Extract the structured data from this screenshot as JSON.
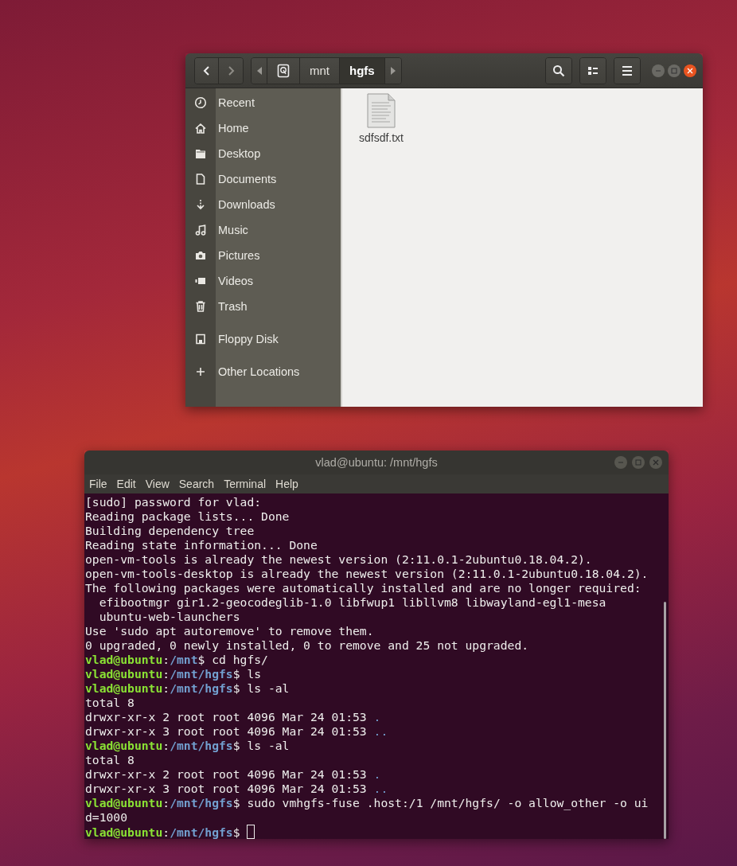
{
  "file_manager": {
    "path_bar": [
      {
        "kind": "drive",
        "selected": false
      },
      {
        "kind": "folder",
        "label": "mnt",
        "selected": false
      },
      {
        "kind": "folder",
        "label": "hgfs",
        "selected": true
      }
    ],
    "sidebar": {
      "sections": [
        [
          {
            "label": "Recent"
          },
          {
            "label": "Home"
          },
          {
            "label": "Desktop"
          },
          {
            "label": "Documents"
          },
          {
            "label": "Downloads"
          },
          {
            "label": "Music"
          },
          {
            "label": "Pictures"
          },
          {
            "label": "Videos"
          },
          {
            "label": "Trash"
          }
        ],
        [
          {
            "label": "Floppy Disk"
          }
        ],
        [
          {
            "label": "Other Locations"
          }
        ]
      ]
    },
    "files": [
      {
        "name": "sdfsdf.txt"
      }
    ]
  },
  "terminal": {
    "title": "vlad@ubuntu: /mnt/hgfs",
    "menu": [
      "File",
      "Edit",
      "View",
      "Search",
      "Terminal",
      "Help"
    ],
    "cursor": true,
    "lines": [
      [
        {
          "kind": "text",
          "text": "[sudo] password for vlad:"
        }
      ],
      [
        {
          "kind": "text",
          "text": "Reading package lists... Done"
        }
      ],
      [
        {
          "kind": "text",
          "text": "Building dependency tree"
        }
      ],
      [
        {
          "kind": "text",
          "text": "Reading state information... Done"
        }
      ],
      [
        {
          "kind": "text",
          "text": "open-vm-tools is already the newest version (2:11.0.1-2ubuntu0.18.04.2)."
        }
      ],
      [
        {
          "kind": "text",
          "text": "open-vm-tools-desktop is already the newest version (2:11.0.1-2ubuntu0.18.04.2)."
        }
      ],
      [
        {
          "kind": "text",
          "text": "The following packages were automatically installed and are no longer required:"
        }
      ],
      [
        {
          "kind": "text",
          "text": "  efibootmgr gir1.2-geocodeglib-1.0 libfwup1 libllvm8 libwayland-egl1-mesa"
        }
      ],
      [
        {
          "kind": "text",
          "text": "  ubuntu-web-launchers"
        }
      ],
      [
        {
          "kind": "text",
          "text": "Use 'sudo apt autoremove' to remove them."
        }
      ],
      [
        {
          "kind": "text",
          "text": "0 upgraded, 0 newly installed, 0 to remove and 25 not upgraded."
        }
      ],
      [
        {
          "kind": "user",
          "text": "vlad@ubuntu"
        },
        {
          "kind": "text",
          "text": ":"
        },
        {
          "kind": "path",
          "text": "/mnt"
        },
        {
          "kind": "text",
          "text": "$ cd hgfs/"
        }
      ],
      [
        {
          "kind": "user",
          "text": "vlad@ubuntu"
        },
        {
          "kind": "text",
          "text": ":"
        },
        {
          "kind": "path",
          "text": "/mnt/hgfs"
        },
        {
          "kind": "text",
          "text": "$ ls"
        }
      ],
      [
        {
          "kind": "user",
          "text": "vlad@ubuntu"
        },
        {
          "kind": "text",
          "text": ":"
        },
        {
          "kind": "path",
          "text": "/mnt/hgfs"
        },
        {
          "kind": "text",
          "text": "$ ls -al"
        }
      ],
      [
        {
          "kind": "text",
          "text": "total 8"
        }
      ],
      [
        {
          "kind": "text",
          "text": "drwxr-xr-x 2 root root 4096 Mar 24 01:53 "
        },
        {
          "kind": "dir",
          "text": "."
        }
      ],
      [
        {
          "kind": "text",
          "text": "drwxr-xr-x 3 root root 4096 Mar 24 01:53 "
        },
        {
          "kind": "dir",
          "text": ".."
        }
      ],
      [
        {
          "kind": "user",
          "text": "vlad@ubuntu"
        },
        {
          "kind": "text",
          "text": ":"
        },
        {
          "kind": "path",
          "text": "/mnt/hgfs"
        },
        {
          "kind": "text",
          "text": "$ ls -al"
        }
      ],
      [
        {
          "kind": "text",
          "text": "total 8"
        }
      ],
      [
        {
          "kind": "text",
          "text": "drwxr-xr-x 2 root root 4096 Mar 24 01:53 "
        },
        {
          "kind": "dir",
          "text": "."
        }
      ],
      [
        {
          "kind": "text",
          "text": "drwxr-xr-x 3 root root 4096 Mar 24 01:53 "
        },
        {
          "kind": "dir",
          "text": ".."
        }
      ],
      [
        {
          "kind": "user",
          "text": "vlad@ubuntu"
        },
        {
          "kind": "text",
          "text": ":"
        },
        {
          "kind": "path",
          "text": "/mnt/hgfs"
        },
        {
          "kind": "text",
          "text": "$ sudo vmhgfs-fuse .host:/1 /mnt/hgfs/ -o allow_other -o ui"
        }
      ],
      [
        {
          "kind": "text",
          "text": "d=1000"
        }
      ],
      [
        {
          "kind": "user",
          "text": "vlad@ubuntu"
        },
        {
          "kind": "text",
          "text": ":"
        },
        {
          "kind": "path",
          "text": "/mnt/hgfs"
        },
        {
          "kind": "text",
          "text": "$ "
        }
      ]
    ]
  }
}
